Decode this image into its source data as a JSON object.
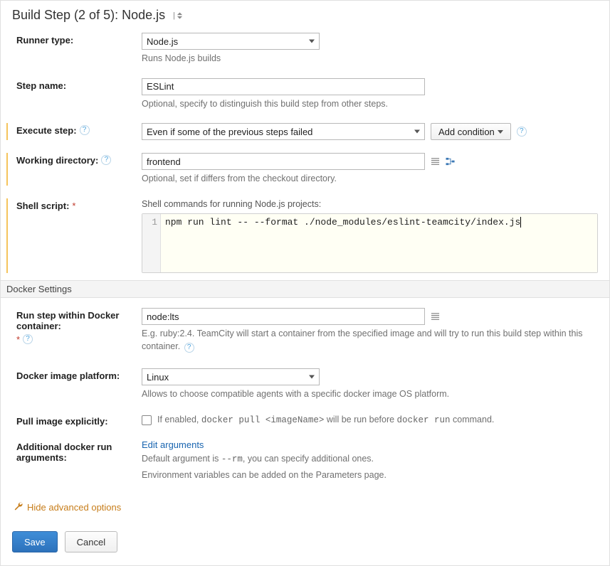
{
  "title": {
    "full": "Build Step (2 of 5): Node.js",
    "sep": "|"
  },
  "runner": {
    "label": "Runner type:",
    "value": "Node.js",
    "desc": "Runs Node.js builds"
  },
  "step_name": {
    "label": "Step name:",
    "value": "ESLint",
    "desc": "Optional, specify to distinguish this build step from other steps."
  },
  "execute": {
    "label": "Execute step:",
    "value": "Even if some of the previous steps failed",
    "add_condition": "Add condition"
  },
  "workdir": {
    "label": "Working directory:",
    "value": "frontend",
    "desc": "Optional, set if differs from the checkout directory."
  },
  "script": {
    "label": "Shell script:",
    "heading": "Shell commands for running Node.js projects:",
    "line_no": "1",
    "code": "npm run lint -- --format ./node_modules/eslint-teamcity/index.js"
  },
  "docker_section": "Docker Settings",
  "docker_container": {
    "label": "Run step within Docker container:",
    "value": "node:lts",
    "desc": "E.g. ruby:2.4. TeamCity will start a container from the specified image and will try to run this build step within this container."
  },
  "docker_platform": {
    "label": "Docker image platform:",
    "value": "Linux",
    "desc": "Allows to choose compatible agents with a specific docker image OS platform."
  },
  "pull_image": {
    "label": "Pull image explicitly:",
    "desc_prefix": "If enabled, ",
    "code1": "docker pull <imageName>",
    "desc_mid": " will be run before ",
    "code2": "docker run",
    "desc_suffix": " command."
  },
  "docker_args": {
    "label": "Additional docker run arguments:",
    "link": "Edit arguments",
    "desc1_prefix": "Default argument is ",
    "desc1_code": "--rm",
    "desc1_suffix": ", you can specify additional ones.",
    "desc2": "Environment variables can be added on the Parameters page."
  },
  "hide_advanced": "Hide advanced options",
  "footer": {
    "save": "Save",
    "cancel": "Cancel"
  }
}
